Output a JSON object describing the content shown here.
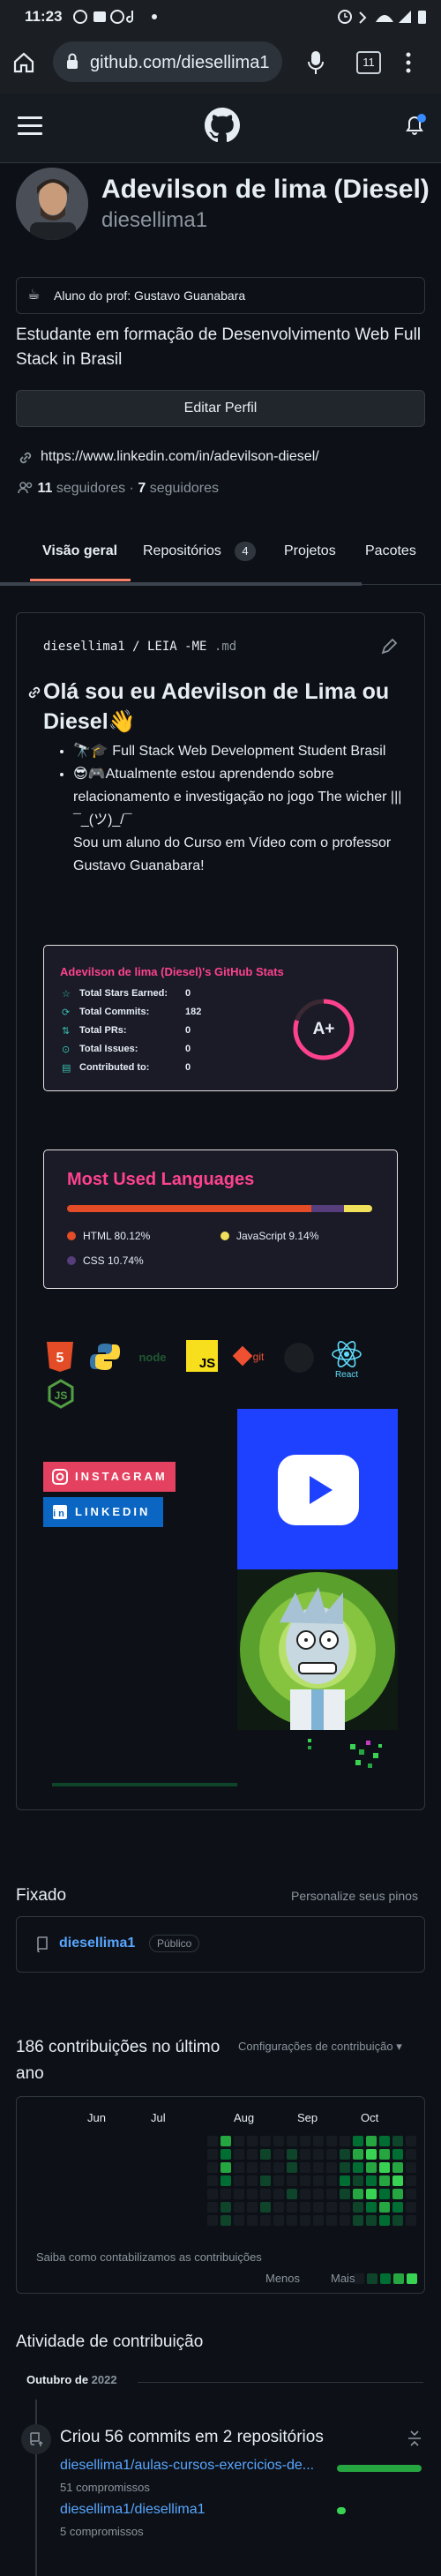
{
  "status_bar": {
    "time": "11:23"
  },
  "browser": {
    "url": "github.com/diesellima1",
    "tab_count": "11"
  },
  "profile": {
    "name": "Adevilson de lima (Diesel)",
    "login": "diesellima1",
    "status": "Aluno do prof: Gustavo Guanabara",
    "bio": "Estudante em formação de Desenvolvimento Web Full Stack in Brasil",
    "edit_button": "Editar Perfil",
    "website": "https://www.linkedin.com/in/adevilson-diesel/",
    "followers_count": "11",
    "followers_label": "seguidores",
    "following_count": "7",
    "following_label": "seguidores"
  },
  "tabs": [
    {
      "label": "Visão geral"
    },
    {
      "label": "Repositórios",
      "count": "4"
    },
    {
      "label": "Projetos"
    },
    {
      "label": "Pacotes"
    }
  ],
  "readme": {
    "path_user": "diesellima1",
    "path_file": "LEIA -ME",
    "ext": ".md",
    "heading": "Olá sou eu Adevilson de Lima ou Diesel",
    "bullet1": "Full Stack Web Development Student Brasil",
    "bullet2": "Atualmente estou aprendendo sobre relacionamento e investigação no jogo The wicher ||| ¯_(ツ)_/¯",
    "bullet2b": "Sou um aluno do Curso em Vídeo com o professor Gustavo Guanabara!",
    "stats": {
      "title": "Adevilson de lima (Diesel)'s GitHub Stats",
      "rows": [
        {
          "label": "Total Stars Earned:",
          "value": "0"
        },
        {
          "label": "Total Commits:",
          "value": "182"
        },
        {
          "label": "Total PRs:",
          "value": "0"
        },
        {
          "label": "Total Issues:",
          "value": "0"
        },
        {
          "label": "Contributed to:",
          "value": "0"
        }
      ],
      "grade": "A+"
    },
    "languages": {
      "title": "Most Used Languages",
      "items": [
        {
          "name": "HTML",
          "percent": 80.12,
          "label": "80.12%",
          "color": "#e34c26"
        },
        {
          "name": "JavaScript",
          "percent": 9.14,
          "label": "9.14%",
          "color": "#f1e05a"
        },
        {
          "name": "CSS",
          "percent": 10.74,
          "label": "10.74%",
          "color": "#563d7c"
        }
      ]
    },
    "badges": {
      "instagram": "INSTAGRAM",
      "linkedin": "LINKEDIN"
    },
    "tech_icons": [
      "html5-icon",
      "python-icon",
      "nodejs-icon",
      "javascript-icon",
      "git-icon",
      "github-icon",
      "react-icon",
      "nodejs-icon"
    ],
    "react_label": "React"
  },
  "pinned": {
    "title": "Fixado",
    "customize": "Personalize seus pinos",
    "repo": "diesellima1",
    "visibility": "Público"
  },
  "contributions": {
    "title": "186 contribuições no último ano",
    "settings": "Configurações de contribuição",
    "months": [
      "Jun",
      "Jul",
      "Aug",
      "Sep",
      "Oct"
    ],
    "learn": "Saiba como contabilizamos as contribuições",
    "less": "Menos",
    "more": "Mais"
  },
  "activity": {
    "title": "Atividade de contribuição",
    "period_month": "Outubro de",
    "period_year": "2022",
    "summary": "Criou 56 commits em 2 repositórios",
    "repos": [
      {
        "name": "diesellima1/aulas-cursos-exercicios-de...",
        "commits": "51 compromissos",
        "fraction": 1.0
      },
      {
        "name": "diesellima1/diesellima1",
        "commits": "5 compromissos",
        "fraction": 0.1
      }
    ]
  },
  "colors": {
    "accent": "#58a6ff",
    "tab_underline": "#f78166",
    "bg": "#0d1117",
    "card": "#161b22"
  }
}
